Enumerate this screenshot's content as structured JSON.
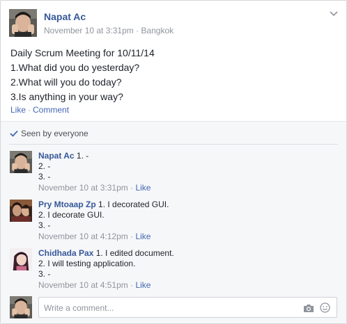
{
  "post": {
    "author": "Napat Ac",
    "timestamp": "November 10 at 3:31pm",
    "separator": " · ",
    "location": "Bangkok",
    "lines": [
      "Daily Scrum Meeting for 10/11/14",
      "1.What did you do yesterday?",
      "2.What will you do today?",
      "3.Is anything in your way?"
    ],
    "like_label": "Like",
    "action_separator": "·",
    "comment_label": "Comment"
  },
  "seen": {
    "label": "Seen by everyone"
  },
  "comments": [
    {
      "author": "Napat Ac",
      "line1": "1. -",
      "line2": "2. -",
      "line3": "3. -",
      "time": "November 10 at 3:31pm",
      "separator": "·",
      "like": "Like"
    },
    {
      "author": "Pry Mtoaap Zp",
      "line1": "1. I decorated GUI.",
      "line2": "2. I decorate GUI.",
      "line3": "3. -",
      "time": "November 10 at 4:12pm",
      "separator": "·",
      "like": "Like"
    },
    {
      "author": "Chidhada Pax",
      "line1": "1. I edited document.",
      "line2": "2. I will testing application.",
      "line3": "3. -",
      "time": "November 10 at 4:51pm",
      "separator": "·",
      "like": "Like"
    }
  ],
  "composer": {
    "placeholder": "Write a comment..."
  },
  "icons": {
    "chevron": "chevron-down-icon",
    "seen": "checkmark-icon",
    "camera": "camera-icon",
    "emoji": "smiley-icon"
  },
  "colors": {
    "link": "#365899",
    "action": "#4267b2",
    "meta": "#90949c",
    "ufi_bg": "#f6f7f9"
  }
}
